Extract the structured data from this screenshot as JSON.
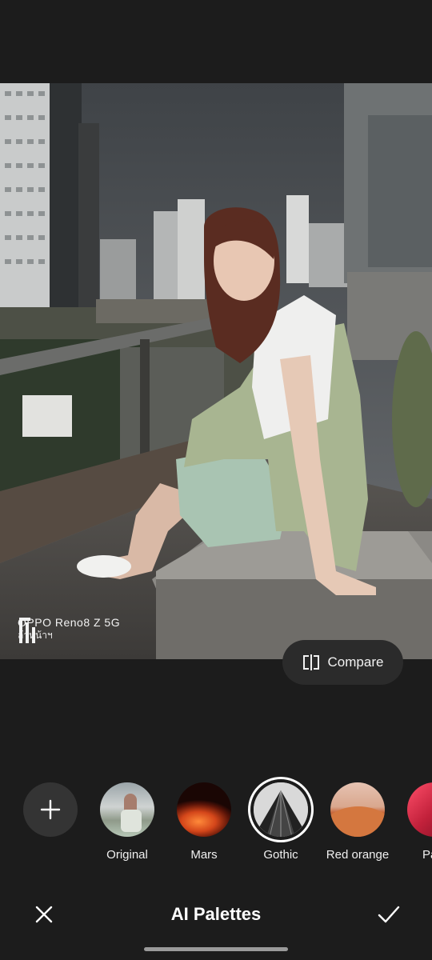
{
  "photo": {
    "watermark_model": "OPPO Reno8 Z 5G",
    "watermark_sub": "ล้าหน้าฯ",
    "logo_icon": "oppo-frame-logo-icon"
  },
  "compare": {
    "label": "Compare",
    "icon": "compare-icon"
  },
  "palettes": {
    "add_icon": "plus-icon",
    "items": [
      {
        "label": "Original",
        "selected": false
      },
      {
        "label": "Mars",
        "selected": false
      },
      {
        "label": "Gothic",
        "selected": true
      },
      {
        "label": "Red orange",
        "selected": false
      },
      {
        "label": "Pale",
        "selected": false
      }
    ]
  },
  "bottom_bar": {
    "title": "AI Palettes",
    "close_icon": "close-icon",
    "confirm_icon": "checkmark-icon"
  },
  "colors": {
    "background": "#1c1c1c",
    "accent": "#ffffff"
  }
}
